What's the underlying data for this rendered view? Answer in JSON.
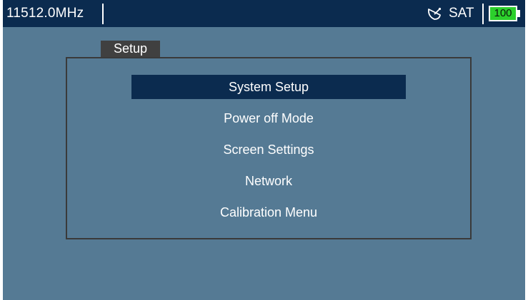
{
  "status_bar": {
    "frequency": "11512.0MHz",
    "signal_icon": "satellite-dish-icon",
    "mode": "SAT",
    "battery_level": "100",
    "battery_color": "#2cd02c"
  },
  "panel": {
    "tab_label": "Setup"
  },
  "menu": {
    "selected_index": 0,
    "items": [
      {
        "label": "System Setup"
      },
      {
        "label": "Power off Mode"
      },
      {
        "label": "Screen Settings"
      },
      {
        "label": "Network"
      },
      {
        "label": "Calibration Menu"
      }
    ]
  },
  "colors": {
    "background": "#557a94",
    "bar": "#0b2b4f",
    "highlight": "#0b2b4f",
    "tab": "#404040"
  }
}
